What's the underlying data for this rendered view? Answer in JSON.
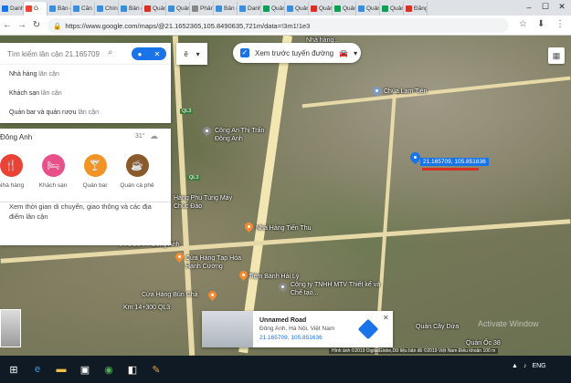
{
  "browser": {
    "tabs": [
      {
        "label": "Danh",
        "color": "#1a73e8"
      },
      {
        "label": "G",
        "color": "#ea4335",
        "active": true
      },
      {
        "label": "Bản đ",
        "color": "#3c8dde"
      },
      {
        "label": "Căn tu",
        "color": "#3c8dde"
      },
      {
        "label": "Chính",
        "color": "#3c8dde"
      },
      {
        "label": "Bản đ",
        "color": "#3c8dde"
      },
      {
        "label": "Quản",
        "color": "#d93025"
      },
      {
        "label": "Quản",
        "color": "#3c8dde"
      },
      {
        "label": "Phân",
        "color": "#888888"
      },
      {
        "label": "Bản đ",
        "color": "#3c8dde"
      },
      {
        "label": "Danh",
        "color": "#3c8dde"
      },
      {
        "label": "Quản",
        "color": "#0f9d58"
      },
      {
        "label": "Quản",
        "color": "#3c8dde"
      },
      {
        "label": "Quản",
        "color": "#d93025"
      },
      {
        "label": "Quản",
        "color": "#0f9d58"
      },
      {
        "label": "Quản",
        "color": "#3c8dde"
      },
      {
        "label": "Quản",
        "color": "#0f9d58"
      },
      {
        "label": "Đăng",
        "color": "#d93025"
      }
    ],
    "url": "https://www.google.com/maps/@21.1652365,105.8490635,721m/data=!3m1!1e3"
  },
  "search": {
    "placeholder": "Tìm kiếm lân cận 21.165709",
    "suggestions": [
      {
        "strong": "Nhà hàng",
        "muted": " lân cận"
      },
      {
        "strong": "Khách sạn",
        "muted": " lân cận"
      },
      {
        "strong": "Quán bar và quán rượu",
        "muted": " lân cận"
      }
    ]
  },
  "language_button": "ê",
  "street_view_label": "Xem trước tuyến đường",
  "nearby": {
    "place": "Đông Anh",
    "temperature": "31°",
    "categories": [
      {
        "label": "Nhà hàng",
        "color": "#ea4335",
        "icon": "restaurant-icon"
      },
      {
        "label": "Khách sạn",
        "color": "#e8508b",
        "icon": "hotel-icon"
      },
      {
        "label": "Quán bar",
        "color": "#f29423",
        "icon": "bar-icon"
      },
      {
        "label": "Quán cà phê",
        "color": "#8b5a2b",
        "icon": "coffee-icon"
      }
    ],
    "info": "Xem thời gian di chuyển, giao thông và các địa điểm lân cận"
  },
  "map_labels": {
    "nha_hang_tren": "Nhà hàng...",
    "chua": "Chùa Lam Tiên",
    "cong_an": "Công An Thị Trấn Đông Anh",
    "hang_phu": "Hàng Phụ Tùng Máy Chúc Đào",
    "nha_hang_tien_thu": "Nhà Hàng Tiến Thu",
    "ttdong_anh": "6 Tổ 26 TT Đông Anh",
    "cua_hang_tap_hoa": "Cửa Hàng Tạp Hóa Hạnh Cường",
    "tiem_banh": "Tiệm Bánh Hải Lý",
    "cong_ty": "Công ty TNHH MTV Thiết kế và Chế tạo...",
    "cua_hang_bun": "Cửa Hàng Bún Chả",
    "km": "Km 14+300 QL3",
    "quan_cay_dua": "Quán Cây Dừa",
    "quan_oc": "Quán Ốc 38",
    "ql3_a": "QL3",
    "ql3_b": "QL3"
  },
  "pin_label": "21.165709, 105.851636",
  "location_card": {
    "title": "Unnamed Road",
    "address": "Đông Anh, Hà Nội, Việt Nam",
    "coords": "21.165709, 105.851636"
  },
  "watermark": "Activate Window",
  "attribution": "Hình ảnh ©2019 DigitalGlobe,Dữ liệu bản đồ ©2019   Việt Nam   Điều khoản   100 m",
  "tray": {
    "lang": "ENG"
  }
}
